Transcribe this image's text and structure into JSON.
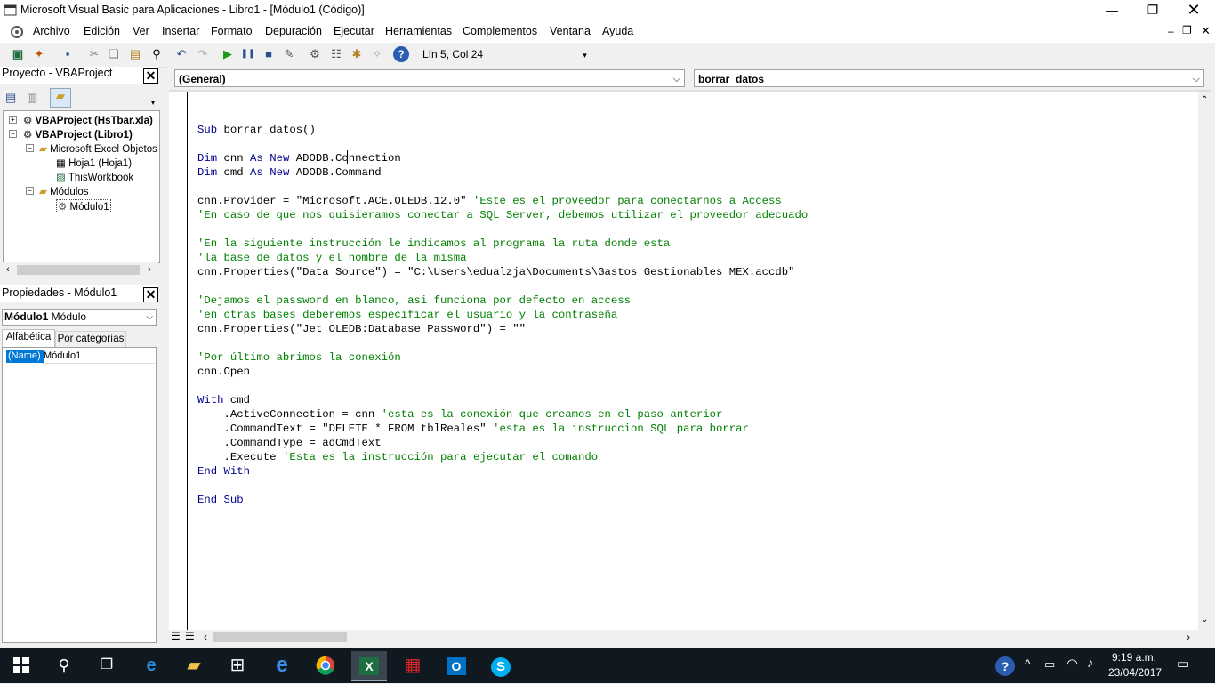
{
  "window": {
    "title": "Microsoft Visual Basic para Aplicaciones - Libro1 - [Módulo1 (Código)]"
  },
  "menu": [
    {
      "pre": "",
      "u": "A",
      "post": "rchivo"
    },
    {
      "pre": "",
      "u": "E",
      "post": "dición"
    },
    {
      "pre": "",
      "u": "V",
      "post": "er"
    },
    {
      "pre": "",
      "u": "I",
      "post": "nsertar"
    },
    {
      "pre": "F",
      "u": "o",
      "post": "rmato"
    },
    {
      "pre": "",
      "u": "D",
      "post": "epuración"
    },
    {
      "pre": "Eje",
      "u": "c",
      "post": "utar"
    },
    {
      "pre": "",
      "u": "H",
      "post": "erramientas"
    },
    {
      "pre": "",
      "u": "C",
      "post": "omplementos"
    },
    {
      "pre": "Ve",
      "u": "n",
      "post": "tana"
    },
    {
      "pre": "Ay",
      "u": "u",
      "post": "da"
    }
  ],
  "toolbar": {
    "position": "Lín 5, Col 24"
  },
  "project": {
    "title": "Proyecto - VBAProject",
    "items": [
      {
        "label": "VBAProject (HsTbar.xla)",
        "bold": true
      },
      {
        "label": "VBAProject (Libro1)",
        "bold": true
      },
      {
        "label": "Microsoft Excel Objetos",
        "bold": false
      },
      {
        "label": "Hoja1 (Hoja1)",
        "bold": false
      },
      {
        "label": "ThisWorkbook",
        "bold": false
      },
      {
        "label": "Módulos",
        "bold": false
      },
      {
        "label": "Módulo1",
        "bold": false
      }
    ]
  },
  "properties": {
    "title": "Propiedades - Módulo1",
    "object_bold": "Módulo1",
    "object_type": "Módulo",
    "tabs": [
      "Alfabética",
      "Por categorías"
    ],
    "row_name": "(Name)",
    "row_value": "Módulo1"
  },
  "code_window": {
    "object_combo": "(General)",
    "proc_combo": "borrar_datos",
    "lines": [
      "",
      "Sub borrar_datos()",
      "",
      "Dim cnn As New ADODB.Connection",
      "Dim cmd As New ADODB.Command",
      "",
      "cnn.Provider = \"Microsoft.ACE.OLEDB.12.0\" 'Este es el proveedor para conectarnos a Access",
      "'En caso de que nos quisieramos conectar a SQL Server, debemos utilizar el proveedor adecuado",
      "",
      "'En la siguiente instrucción le indicamos al programa la ruta donde esta",
      "'la base de datos y el nombre de la misma",
      "cnn.Properties(\"Data Source\") = \"C:\\Users\\edualzja\\Documents\\Gastos Gestionables MEX.accdb\"",
      "",
      "'Dejamos el password en blanco, asi funciona por defecto en access",
      "'en otras bases deberemos especificar el usuario y la contraseña",
      "cnn.Properties(\"Jet OLEDB:Database Password\") = \"\"",
      "",
      "'Por último abrimos la conexión",
      "cnn.Open",
      "",
      "With cmd",
      "    .ActiveConnection = cnn 'esta es la conexión que creamos en el paso anterior",
      "    .CommandText = \"DELETE * FROM tblReales\" 'esta es la instruccion SQL para borrar",
      "    .CommandType = adCmdText",
      "    .Execute 'Esta es la instrucción para ejecutar el comando",
      "End With",
      "",
      "End Sub"
    ]
  },
  "taskbar": {
    "time": "9:19 a.m.",
    "date": "23/04/2017"
  },
  "colors": {
    "keyword": "#00008b",
    "comment": "#008000",
    "taskbar": "#101820",
    "selection": "#0078d7"
  }
}
